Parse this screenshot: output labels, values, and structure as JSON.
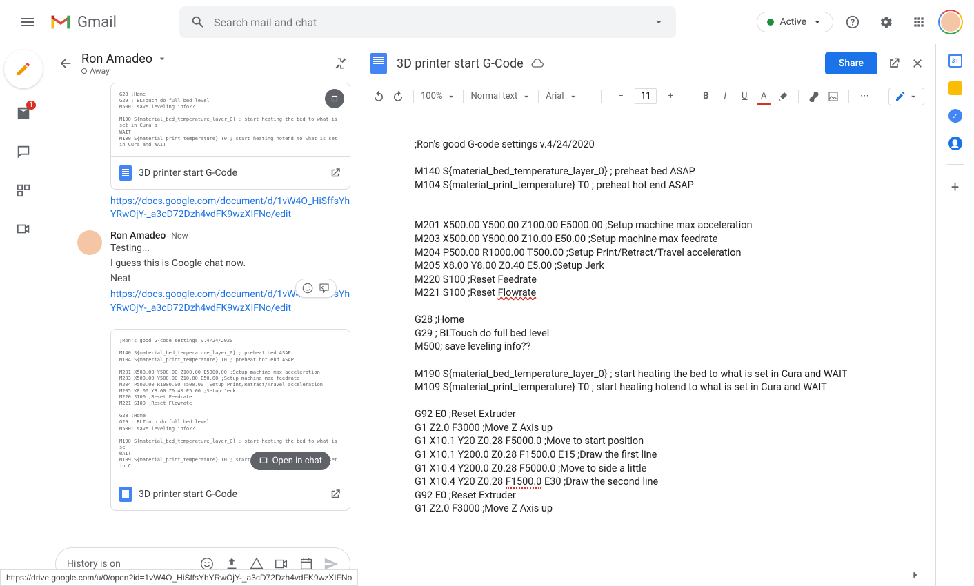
{
  "header": {
    "logo_text": "Gmail",
    "search_placeholder": "Search mail and chat",
    "active_status": "Active"
  },
  "rail": {
    "mail_badge": "1"
  },
  "chat": {
    "back": "←",
    "user_name": "Ron Amadeo",
    "status": "Away",
    "card1_title": "3D printer start G-Code",
    "link1": "https://docs.google.com/document/d/1vW4O_HiSffsYhYRwOjY-_a3cD72Dzh4vdFK9wzXIFNo/edit",
    "msg_name": "Ron Amadeo",
    "msg_time": "Now",
    "msg1": "Testing...",
    "msg2": "I guess this is Google chat now.",
    "msg3": "Neat",
    "link2": "https://docs.google.com/document/d/1vW4O_HiSffsYhYRwOjY-_a3cD72Dzh4vdFK9wzXIFNo/edit",
    "card2_title": "3D printer start G-Code",
    "open_in_chat": "Open in chat",
    "history": "History is on",
    "preview_small": "G28 ;Home\nG29 ; BLTouch do full bed level\nM500; save leveling info??\n\nM190 S{material_bed_temperature_layer_0} ; start heating the bed to what is set in Cura a\nWAIT\nM109 S{material_print_temperature} T0 ; start heating hotend to what is set in Cura and WAIT",
    "preview_large": ";Ron's good G-code settings v.4/24/2020\n\nM140 S{material_bed_temperature_layer_0} ; preheat bed ASAP\nM104 S{material_print_temperature} T0 ; preheat hot end ASAP\n\nM201 X500.00 Y500.00 Z100.00 E5000.00 ;Setup machine max acceleration\nM203 X500.00 Y500.00 Z10.00 E50.00 ;Setup machine max feedrate\nM204 P500.00 R1000.00 T500.00 ;Setup Print/Retract/Travel acceleration\nM205 X8.00 Y8.00 Z0.40 E5.00 ;Setup Jerk\nM220 S100 ;Reset Feedrate\nM221 S100 ;Reset Flowrate\n\nG28 ;Home\nG29 ; BLTouch do full bed level\nM500; save leveling info??\n\nM190 S{material_bed_temperature_layer_0} ; start heating the bed to what is se\nWAIT\nM109 S{material_print_temperature} T0 ; start heating hotend to what is set in C"
  },
  "doc": {
    "title": "3D printer start G-Code",
    "share": "Share",
    "zoom": "100%",
    "style": "Normal text",
    "font": "Arial",
    "size": "11",
    "lines": [
      ";Ron's good G-code settings v.4/24/2020",
      "",
      "M140 S{material_bed_temperature_layer_0} ; preheat bed ASAP",
      "M104 S{material_print_temperature} T0 ; preheat hot end ASAP",
      "",
      "",
      "M201 X500.00 Y500.00 Z100.00 E5000.00 ;Setup machine max acceleration",
      "M203 X500.00 Y500.00 Z10.00 E50.00 ;Setup machine max feedrate",
      "M204 P500.00 R1000.00 T500.00 ;Setup Print/Retract/Travel acceleration",
      "M205 X8.00 Y8.00 Z0.40 E5.00 ;Setup Jerk",
      "M220 S100 ;Reset Feedrate",
      "M221 S100 ;Reset ",
      "",
      "G28 ;Home",
      "G29 ; BLTouch do full bed level",
      "M500; save leveling info??",
      "",
      "M190 S{material_bed_temperature_layer_0} ; start heating the bed to what is set in Cura and WAIT",
      "M109 S{material_print_temperature} T0 ; start heating hotend to what is set in Cura and WAIT",
      "",
      "G92 E0 ;Reset Extruder",
      "G1 Z2.0 F3000 ;Move Z Axis up",
      "G1 X10.1 Y20 Z0.28 F5000.0 ;Move to start position",
      "G1 X10.1 Y200.0 Z0.28 F1500.0 E15 ;Draw the first line",
      "G1 X10.4 Y200.0 Z0.28 F5000.0 ;Move to side a little",
      "G1 X10.4 Y20 Z0.28 ",
      "G92 E0 ;Reset Extruder",
      "G1 Z2.0 F3000 ;Move Z Axis up"
    ],
    "flowrate": "Flowrate",
    "f1500": "F1500.0",
    "line_25_rest": " E30 ;Draw the second line"
  },
  "status_url": "https://drive.google.com/u/0/open?id=1vW4O_HiSffsYhYRwOjY-_a3cD72Dzh4vdFK9wzXIFNo"
}
